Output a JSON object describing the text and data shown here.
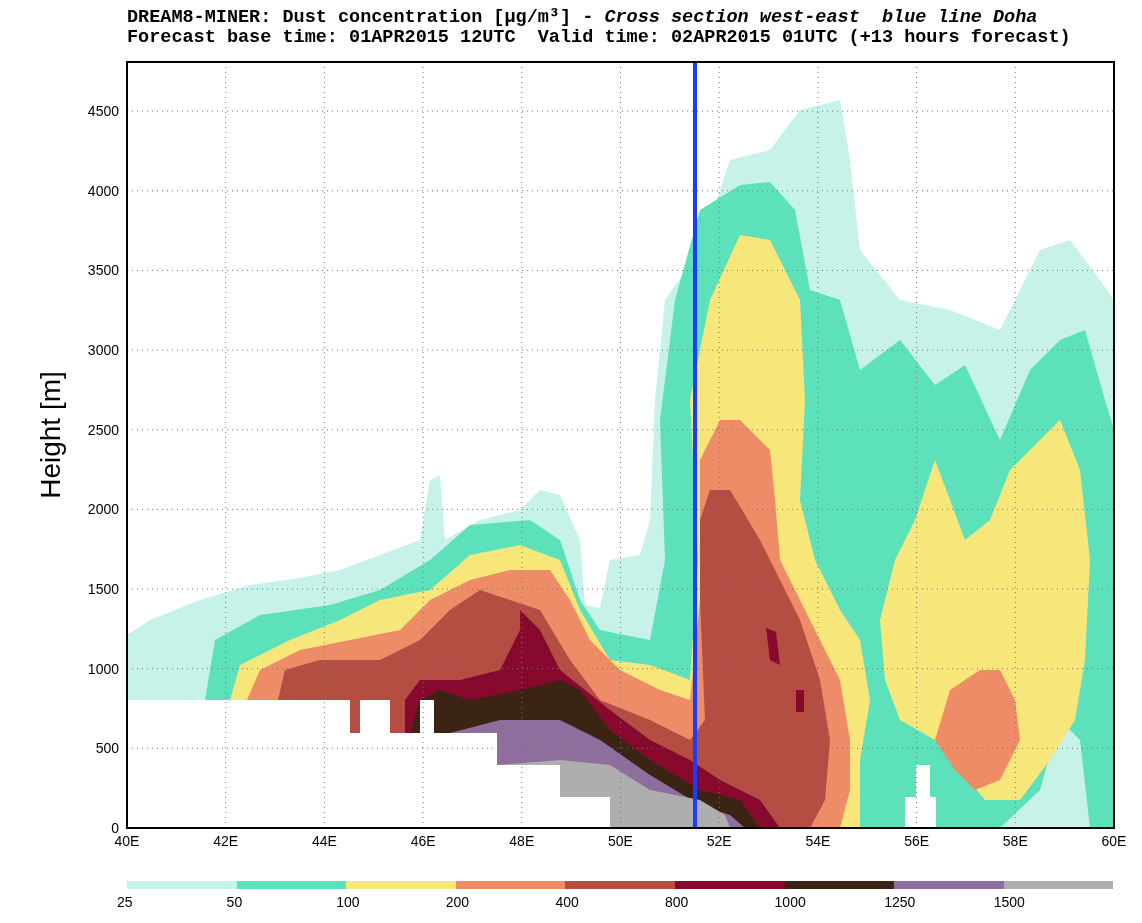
{
  "title": {
    "line_1": "DREAM8-MINER: Dust concentration [μg/m³] - *Cross section west-east  blue line Doha*",
    "line_2": "Forecast base time: 01APR2015 12UTC  Valid time: 02APR2015 01UTC (+13 hours forecast)"
  },
  "plot": {
    "ylabel": "Height [m]",
    "yticks": [
      "4500",
      "4000",
      "3500",
      "3000",
      "2500",
      "2000",
      "1500",
      "1000",
      "500",
      "0"
    ],
    "xticks": [
      "40E",
      "42E",
      "44E",
      "46E",
      "48E",
      "50E",
      "52E",
      "54E",
      "56E",
      "58E",
      "60E"
    ]
  },
  "legend": [
    {
      "label": "25",
      "color": "#c6f2ea"
    },
    {
      "label": "50",
      "color": "#5ce1bb"
    },
    {
      "label": "100",
      "color": "#f7e67a"
    },
    {
      "label": "200",
      "color": "#ed8c67"
    },
    {
      "label": "400",
      "color": "#b44d42"
    },
    {
      "label": "800",
      "color": "#870a2e"
    },
    {
      "label": "1000",
      "color": "#3b2414"
    },
    {
      "label": "1250",
      "color": "#8e6e9c"
    },
    {
      "label": "1500",
      "color": "#aeaeae"
    }
  ]
}
